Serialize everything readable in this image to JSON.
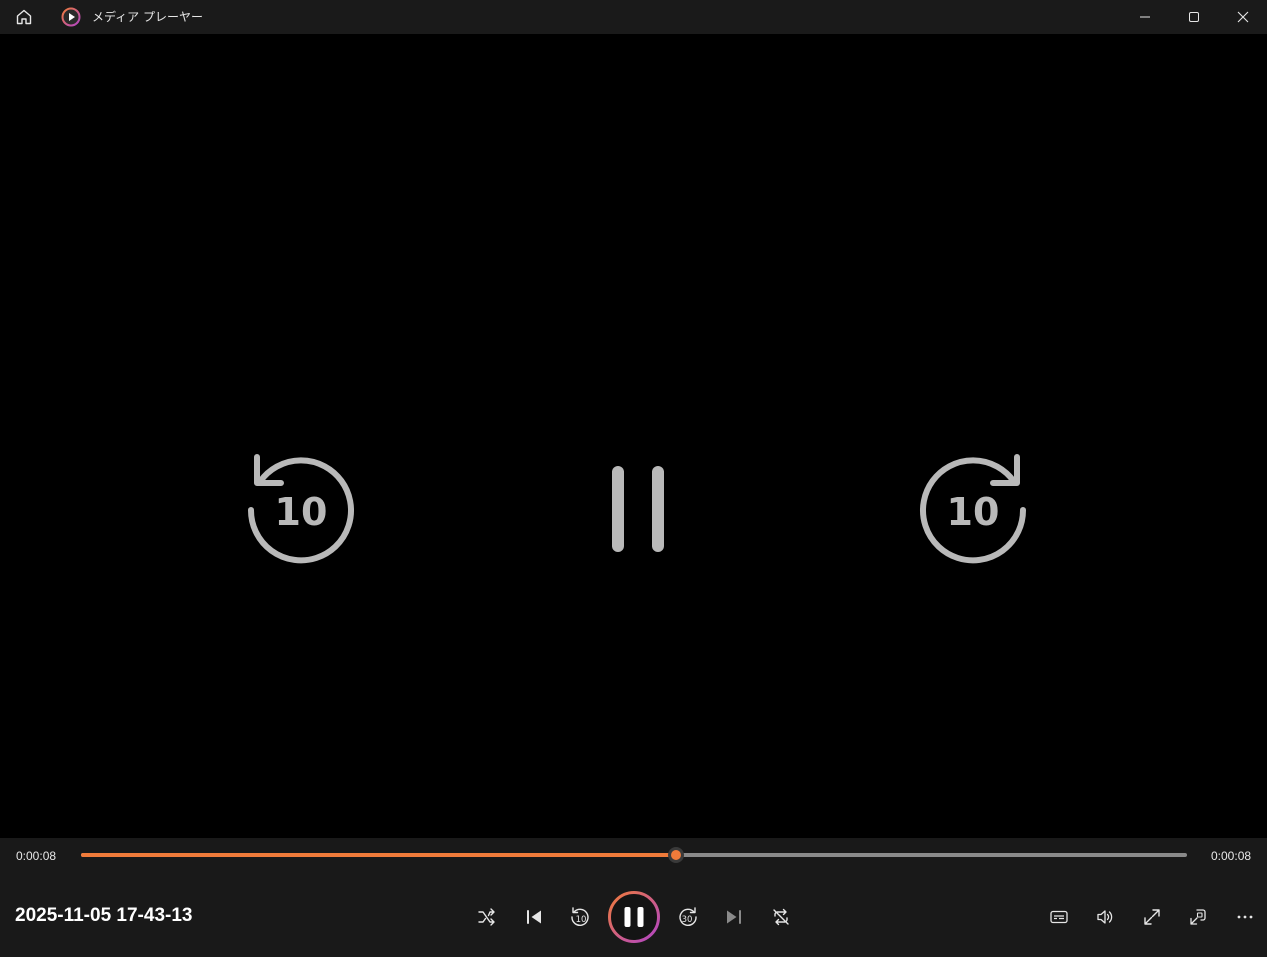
{
  "window": {
    "title": "メディア プレーヤー"
  },
  "player": {
    "elapsed": "0:00:08",
    "duration": "0:00:08",
    "progress_fraction": 0.538,
    "media_title": "2025-11-05 17-43-13",
    "skip_back_seconds": "10",
    "skip_forward_seconds": "30",
    "overlay_skip_seconds": "10"
  },
  "colors": {
    "accent": "#f07b3a",
    "accent_secondary": "#b044c8",
    "overlay_icon": "#b9b9b9",
    "control_bar": "#191919",
    "title_bar": "#1a1a1a"
  },
  "icons": {
    "home": "home-icon",
    "app": "media-player-app-icon",
    "minimize": "minimize-icon",
    "maximize": "maximize-icon",
    "close": "close-icon",
    "shuffle": "shuffle-icon",
    "previous": "previous-track-icon",
    "skip_back": "skip-back-10-icon",
    "pause": "pause-icon",
    "skip_forward": "skip-forward-30-icon",
    "next": "next-track-icon",
    "repeat_off": "repeat-off-icon",
    "captions": "captions-icon",
    "volume": "volume-icon",
    "fullscreen": "fullscreen-icon",
    "mini_player": "mini-player-icon",
    "more": "more-options-icon"
  }
}
